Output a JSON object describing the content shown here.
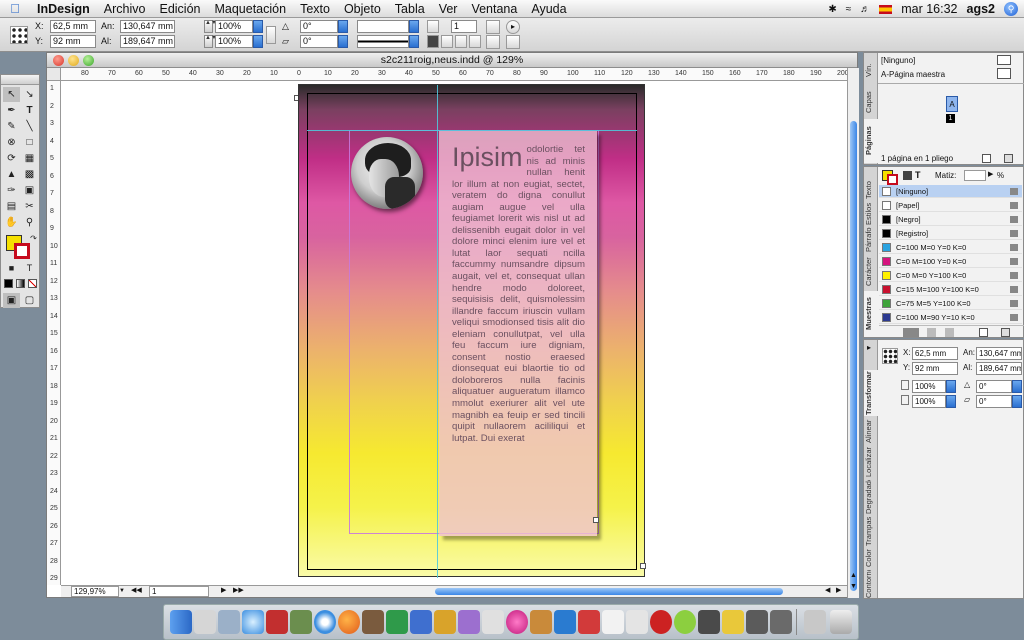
{
  "menubar": {
    "app": "InDesign",
    "items": [
      "Archivo",
      "Edición",
      "Maquetación",
      "Texto",
      "Objeto",
      "Tabla",
      "Ver",
      "Ventana",
      "Ayuda"
    ],
    "clock": "mar 16:32",
    "user": "ags2"
  },
  "control": {
    "x_label": "X:",
    "x": "62,5 mm",
    "y_label": "Y:",
    "y": "92 mm",
    "w_label": "An:",
    "w": "130,647 mm",
    "h_label": "Al:",
    "h": "189,647 mm",
    "scale_x": "100%",
    "scale_y": "100%",
    "angle": "0°",
    "shear": "0°",
    "count": "1"
  },
  "document": {
    "title": "s2c211roig,neus.indd @ 129%",
    "zoom": "129,97%",
    "page": "1",
    "ruler_h": [
      "80",
      "70",
      "60",
      "50",
      "40",
      "30",
      "20",
      "10",
      "0",
      "10",
      "20",
      "30",
      "40",
      "50",
      "60",
      "70",
      "80",
      "90",
      "100",
      "110",
      "120",
      "130",
      "140",
      "150",
      "160",
      "170",
      "180",
      "190",
      "200",
      "21"
    ],
    "ruler_v": [
      "1",
      "2",
      "3",
      "4",
      "5",
      "6",
      "7",
      "8",
      "9",
      "10",
      "11",
      "12",
      "13",
      "14",
      "15",
      "16",
      "17",
      "18",
      "19",
      "20",
      "21",
      "22",
      "23",
      "24",
      "25",
      "26",
      "27",
      "28",
      "29"
    ],
    "story_heading": "Ipisim",
    "story_body": "odolortie tet nis ad minis nullan henit lor illum at non eugiat, sectet, veratem do digna conullut augiam augue vel ulla feugiamet lorerit wis nisl ut ad delissenibh eugait dolor in vel dolore minci elenim iure vel et lutat laor sequati ncilla faccummy numsandre dipsum augait, vel et, consequat ullan hendre modo doloreet, sequisisis delit, quismolessim illandre faccum iriuscin vullam veliqui smodionsed tisis alit dio eleniam conullutpat, vel ulla feu faccum iure digniam, consent nostio eraesed dionsequat eui blaortie tio od doloboreros nulla facinis aliquatuer augueratum illamco mmolut exeriurer alit vel ute magnibh ea feuip er sed tincili quipit nullaorem acililiqui et lutpat. Dui exerat"
  },
  "pages_panel": {
    "tabs": [
      "Páginas",
      "Capas",
      "Vín."
    ],
    "none": "[Ninguno]",
    "master": "A-Página maestra",
    "page_letter": "A",
    "page_number": "1",
    "footer": "1 página en 1 pliego"
  },
  "swatches_panel": {
    "tabs": [
      "Muestras",
      "Carácter",
      "Párrafo",
      "Estilos",
      "Texto"
    ],
    "tint_label": "Matiz:",
    "tint_unit": "%",
    "items": [
      {
        "name": "[Ninguno]",
        "color": "#ffffff"
      },
      {
        "name": "[Papel]",
        "color": "#ffffff"
      },
      {
        "name": "[Negro]",
        "color": "#000000"
      },
      {
        "name": "[Registro]",
        "color": "#000000"
      },
      {
        "name": "C=100 M=0 Y=0 K=0",
        "color": "#2aa3e0"
      },
      {
        "name": "C=0 M=100 Y=0 K=0",
        "color": "#d5137e"
      },
      {
        "name": "C=0 M=0 Y=100 K=0",
        "color": "#fff200"
      },
      {
        "name": "C=15 M=100 Y=100 K=0",
        "color": "#c8102e"
      },
      {
        "name": "C=75 M=5 Y=100 K=0",
        "color": "#3ea33a"
      },
      {
        "name": "C=100 M=90 Y=10 K=0",
        "color": "#2b3990"
      }
    ]
  },
  "transform_panel": {
    "tabs": [
      "Transformar",
      "Alinear",
      "Localizar",
      "Degradado",
      "Trampas",
      "Color",
      "Contorno"
    ],
    "x_label": "X:",
    "x": "62,5 mm",
    "y_label": "Y:",
    "y": "92 mm",
    "w_label": "An:",
    "w": "130,647 mm",
    "h_label": "Al:",
    "h": "189,647 mm",
    "scale_x": "100%",
    "scale_y": "100%",
    "angle": "0°",
    "shear": "0°"
  }
}
